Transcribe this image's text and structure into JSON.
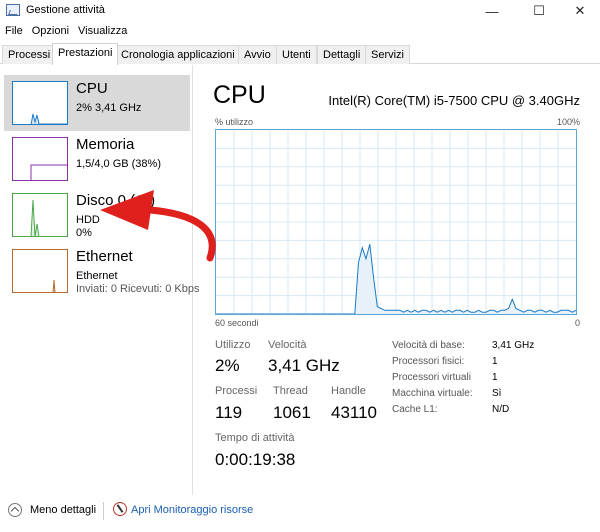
{
  "window": {
    "title": "Gestione attività",
    "buttons": {
      "minimize": "—",
      "maximize": "☐",
      "close": "✕"
    }
  },
  "menu": [
    "File",
    "Opzioni",
    "Visualizza"
  ],
  "tabs": [
    {
      "label": "Processi",
      "active": false
    },
    {
      "label": "Prestazioni",
      "active": true
    },
    {
      "label": "Cronologia applicazioni",
      "active": false
    },
    {
      "label": "Avvio",
      "active": false
    },
    {
      "label": "Utenti",
      "active": false
    },
    {
      "label": "Dettagli",
      "active": false
    },
    {
      "label": "Servizi",
      "active": false
    }
  ],
  "sidebar": {
    "items": [
      {
        "title": "CPU",
        "sub": "2% 3,41 GHz",
        "sub2": "",
        "color": "#1a7ac6",
        "selected": true
      },
      {
        "title": "Memoria",
        "sub": "1,5/4,0 GB (38%)",
        "sub2": "",
        "color": "#8b2fa8",
        "selected": false
      },
      {
        "title": "Disco 0 (C:)",
        "sub": "HDD",
        "sub2": "0%",
        "color": "#4aa84a",
        "selected": false
      },
      {
        "title": "Ethernet",
        "sub": "Ethernet",
        "sub2": "Inviati: 0 Ricevuti: 0 Kbps",
        "color": "#b8692e",
        "selected": false
      }
    ]
  },
  "main": {
    "title": "CPU",
    "cpu_name": "Intel(R) Core(TM) i5-7500 CPU @ 3.40GHz",
    "graph": {
      "y_label": "% utilizzo",
      "y_max": "100%",
      "x_left": "60 secondi",
      "x_right": "0",
      "line_color": "#1a7ac6",
      "samples": [
        0,
        0,
        0,
        0,
        0,
        0,
        0,
        0,
        0,
        0,
        0,
        0,
        0,
        0,
        0,
        0,
        0,
        0,
        0,
        0,
        0,
        0,
        0,
        0,
        0,
        0,
        0,
        0,
        0,
        0,
        0,
        0,
        0,
        0,
        0,
        0,
        0,
        0,
        28,
        36,
        30,
        38,
        20,
        4,
        3,
        2,
        2,
        2,
        2,
        2,
        1,
        2,
        1,
        2,
        1,
        2,
        2,
        1,
        2,
        1,
        2,
        1,
        2,
        1,
        2,
        2,
        1,
        2,
        1,
        1,
        2,
        1,
        1,
        2,
        2,
        1,
        2,
        2,
        3,
        8,
        3,
        2,
        1,
        2,
        2,
        1,
        2,
        2,
        1,
        2,
        1,
        1,
        2,
        2,
        2,
        1,
        2
      ]
    },
    "stats": {
      "utilizzo": {
        "label": "Utilizzo",
        "value": "2%"
      },
      "velocita": {
        "label": "Velocità",
        "value": "3,41 GHz"
      },
      "processi": {
        "label": "Processi",
        "value": "119"
      },
      "thread": {
        "label": "Thread",
        "value": "1061"
      },
      "handle": {
        "label": "Handle",
        "value": "43110"
      },
      "uptime": {
        "label": "Tempo di attività",
        "value": "0:00:19:38"
      }
    },
    "specs": [
      {
        "label": "Velocità di base:",
        "value": "3,41 GHz"
      },
      {
        "label": "Processori fisici:",
        "value": "1"
      },
      {
        "label": "Processori virtuali",
        "value": "1"
      },
      {
        "label": "Macchina virtuale:",
        "value": "Sì"
      },
      {
        "label": "Cache L1:",
        "value": "N/D"
      }
    ]
  },
  "footer": {
    "fewer_details": "Meno dettagli",
    "open_monitor": "Apri Monitoraggio risorse"
  },
  "annotation": {
    "arrow_color": "#e0201c"
  }
}
